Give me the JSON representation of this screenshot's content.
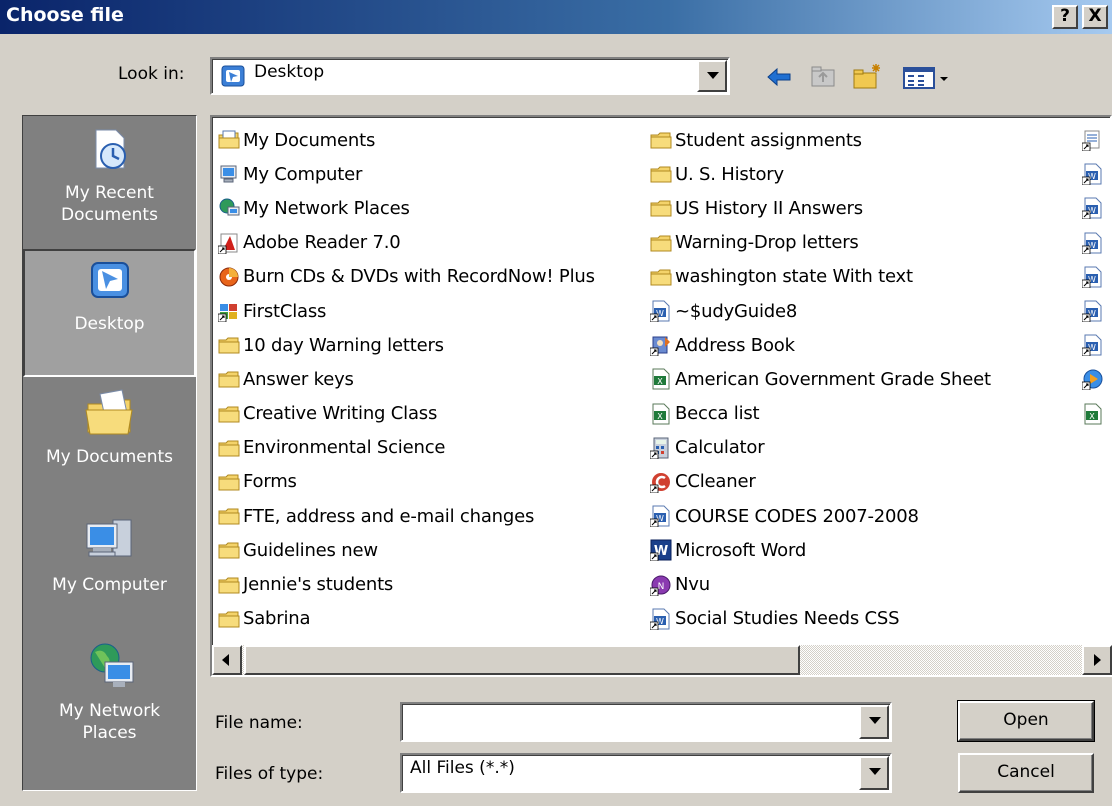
{
  "window": {
    "title": "Choose file",
    "help_button": "?",
    "close_button": "X",
    "colors": {
      "titlebar_start": "#0a246a",
      "titlebar_end": "#a6caf0",
      "face": "#d4d0c8",
      "places_bg": "#808080"
    }
  },
  "look_in": {
    "label": "Look in:",
    "value": "Desktop",
    "icon": "desktop-icon",
    "toolbar": [
      "back-arrow-icon",
      "up-folder-icon",
      "new-folder-icon",
      "view-menu-icon"
    ]
  },
  "places": [
    {
      "label": "My Recent Documents",
      "line1": "My Recent",
      "line2": "Documents",
      "icon": "recent-documents-icon",
      "selected": false
    },
    {
      "label": "Desktop",
      "line1": "Desktop",
      "line2": "",
      "icon": "desktop-icon",
      "selected": true
    },
    {
      "label": "My Documents",
      "line1": "My Documents",
      "line2": "",
      "icon": "my-documents-icon",
      "selected": false
    },
    {
      "label": "My Computer",
      "line1": "My Computer",
      "line2": "",
      "icon": "my-computer-icon",
      "selected": false
    },
    {
      "label": "My Network Places",
      "line1": "My Network",
      "line2": "Places",
      "icon": "network-places-icon",
      "selected": false
    }
  ],
  "files": {
    "column1": [
      {
        "name": "My Documents",
        "icon": "my-documents-icon"
      },
      {
        "name": "My Computer",
        "icon": "my-computer-icon"
      },
      {
        "name": "My Network Places",
        "icon": "network-places-icon"
      },
      {
        "name": "Adobe Reader 7.0",
        "icon": "adobe-reader-icon"
      },
      {
        "name": "Burn CDs & DVDs with RecordNow! Plus",
        "icon": "recordnow-icon"
      },
      {
        "name": "FirstClass",
        "icon": "firstclass-icon"
      },
      {
        "name": "10 day Warning letters",
        "icon": "folder-icon"
      },
      {
        "name": "Answer keys",
        "icon": "folder-icon"
      },
      {
        "name": "Creative Writing Class",
        "icon": "folder-icon"
      },
      {
        "name": "Environmental Science",
        "icon": "folder-icon"
      },
      {
        "name": "Forms",
        "icon": "folder-icon"
      },
      {
        "name": "FTE, address and e-mail changes",
        "icon": "folder-icon"
      },
      {
        "name": "Guidelines new",
        "icon": "folder-icon"
      },
      {
        "name": "Jennie's students",
        "icon": "folder-icon"
      },
      {
        "name": "Sabrina",
        "icon": "folder-icon"
      }
    ],
    "column2": [
      {
        "name": "Student assignments",
        "icon": "folder-icon"
      },
      {
        "name": "U. S. History",
        "icon": "folder-icon"
      },
      {
        "name": "US History II Answers",
        "icon": "folder-icon"
      },
      {
        "name": "Warning-Drop letters",
        "icon": "folder-icon"
      },
      {
        "name": "washington state With text",
        "icon": "folder-icon"
      },
      {
        "name": "~$udyGuide8",
        "icon": "word-document-icon"
      },
      {
        "name": "Address Book",
        "icon": "address-book-icon"
      },
      {
        "name": "American Government Grade Sheet",
        "icon": "excel-document-icon"
      },
      {
        "name": "Becca list",
        "icon": "excel-document-icon"
      },
      {
        "name": "Calculator",
        "icon": "calculator-icon"
      },
      {
        "name": "CCleaner",
        "icon": "ccleaner-icon"
      },
      {
        "name": "COURSE CODES  2007-2008",
        "icon": "word-document-icon"
      },
      {
        "name": "Microsoft Word",
        "icon": "ms-word-icon"
      },
      {
        "name": "Nvu",
        "icon": "nvu-icon"
      },
      {
        "name": "Social Studies Needs CSS",
        "icon": "word-document-icon"
      }
    ],
    "column3_icons": [
      "shortcut-icon",
      "word-document-icon",
      "word-document-icon",
      "word-document-icon",
      "word-document-icon",
      "word-document-icon",
      "word-document-icon",
      "media-icon",
      "excel-document-icon"
    ]
  },
  "file_name": {
    "label": "File name:",
    "value": ""
  },
  "file_type": {
    "label": "Files of type:",
    "value": "All Files (*.*)"
  },
  "buttons": {
    "open": "Open",
    "cancel": "Cancel"
  }
}
